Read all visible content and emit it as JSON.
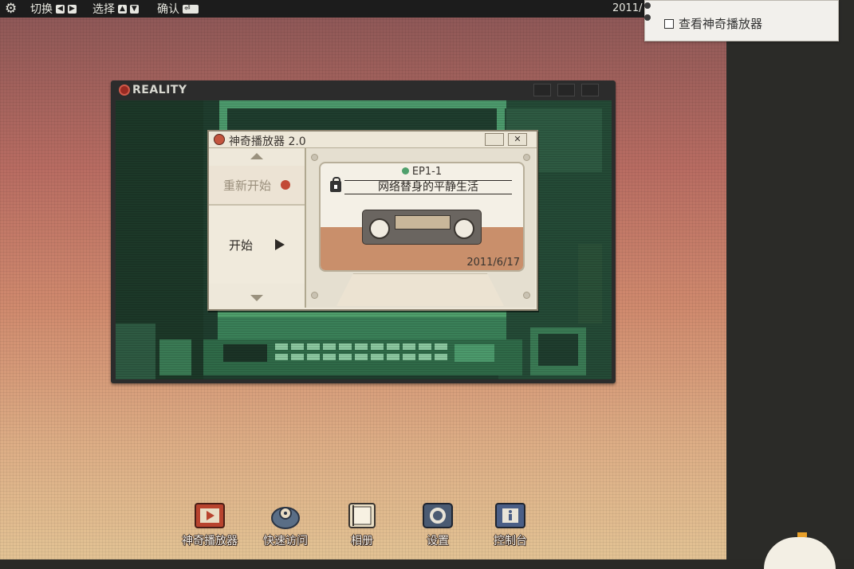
{
  "topbar": {
    "switch_label": "切换",
    "select_label": "选择",
    "confirm_label": "确认",
    "clock": "2011/"
  },
  "dropdown": {
    "item_label": "查看神奇播放器"
  },
  "reality_window": {
    "title": "REALITY"
  },
  "player": {
    "title": "神奇播放器 2.0",
    "close_label": "✕",
    "restart_label": "重新开始",
    "start_label": "开始",
    "cassette": {
      "episode": "EP1-1",
      "title": "网络替身的平静生活",
      "date": "2011/6/17"
    }
  },
  "dock": {
    "items": [
      {
        "label": "神奇播放器",
        "icon": "player-icon"
      },
      {
        "label": "快速访问",
        "icon": "quick-access-icon"
      },
      {
        "label": "相册",
        "icon": "album-icon"
      },
      {
        "label": "设置",
        "icon": "settings-icon"
      },
      {
        "label": "控制台",
        "icon": "console-icon"
      }
    ]
  },
  "colors": {
    "accent_red": "#c24a36",
    "status_green": "#4fa06c",
    "cassette_stripe": "#c98f6b"
  }
}
